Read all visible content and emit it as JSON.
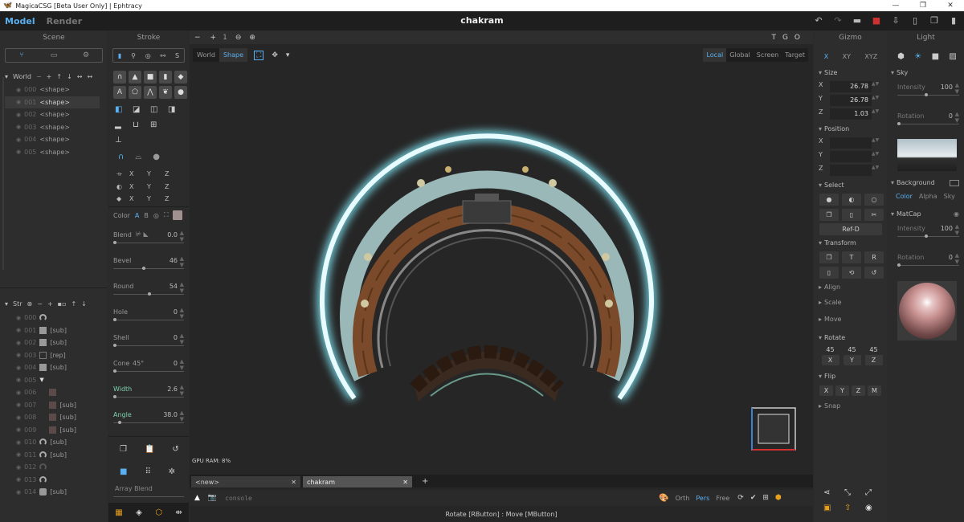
{
  "window": {
    "title": "MagicaCSG [Beta User Only] | Ephtracy",
    "min": "—",
    "max": "❐",
    "close": "✕"
  },
  "menubar": {
    "model": "Model",
    "render": "Render",
    "doc_title": "chakram"
  },
  "scene": {
    "header": "Scene",
    "world_label": "World",
    "world_tools": [
      "+",
      "↑",
      "↓",
      "↔",
      "↔"
    ],
    "items": [
      {
        "num": "000",
        "label": "<shape>"
      },
      {
        "num": "001",
        "label": "<shape>"
      },
      {
        "num": "002",
        "label": "<shape>"
      },
      {
        "num": "003",
        "label": "<shape>"
      },
      {
        "num": "004",
        "label": "<shape>"
      },
      {
        "num": "005",
        "label": "<shape>"
      }
    ],
    "str_label": "Str",
    "str_items": [
      {
        "num": "000",
        "label": ""
      },
      {
        "num": "001",
        "label": "[sub]"
      },
      {
        "num": "002",
        "label": "[sub]"
      },
      {
        "num": "003",
        "label": "[rep]"
      },
      {
        "num": "004",
        "label": "[sub]"
      },
      {
        "num": "005",
        "label": ""
      },
      {
        "num": "006",
        "label": ""
      },
      {
        "num": "007",
        "label": "[sub]"
      },
      {
        "num": "008",
        "label": "[sub]"
      },
      {
        "num": "009",
        "label": "[sub]"
      },
      {
        "num": "010",
        "label": "[sub]"
      },
      {
        "num": "011",
        "label": "[sub]"
      },
      {
        "num": "012",
        "label": ""
      },
      {
        "num": "013",
        "label": ""
      },
      {
        "num": "014",
        "label": "[sub]"
      }
    ]
  },
  "stroke": {
    "header": "Stroke",
    "tab_s": "S",
    "axes": [
      "X",
      "Y",
      "Z"
    ],
    "color_label": "Color",
    "color_a": "A",
    "color_b": "B",
    "blend": {
      "label": "Blend",
      "value": "0.0"
    },
    "bevel": {
      "label": "Bevel",
      "value": "46"
    },
    "round": {
      "label": "Round",
      "value": "54"
    },
    "hole": {
      "label": "Hole",
      "value": "0"
    },
    "shell": {
      "label": "Shell",
      "value": "0"
    },
    "cone": {
      "label": "Cone",
      "angle": "45°",
      "value": "0"
    },
    "width": {
      "label": "Width",
      "value": "2.6"
    },
    "angle": {
      "label": "Angle",
      "value": "38.0"
    },
    "array_blend": "Array Blend"
  },
  "viewport": {
    "zoom_minus": "−",
    "zoom_plus": "+",
    "zoom_val": "1",
    "tgo": [
      "T",
      "G",
      "O"
    ],
    "space_tabs": [
      "World",
      "Shape"
    ],
    "coord_tabs": [
      "Local",
      "Global",
      "Screen",
      "Target"
    ],
    "gpu_ram": "GPU RAM:  8%",
    "tabs": [
      {
        "label": "<new>",
        "close": "✕"
      },
      {
        "label": "chakram",
        "close": "✕"
      }
    ],
    "add_tab": "+",
    "console_placeholder": "console",
    "view_modes": [
      "Orth",
      "Pers",
      "Free"
    ],
    "status": "Rotate [RButton] : Move [MButton]"
  },
  "gizmo": {
    "header": "Gizmo",
    "axis_tabs": [
      "X",
      "XY",
      "XYZ"
    ],
    "size": {
      "label": "Size",
      "x": "26.78",
      "y": "26.78",
      "z": "1.03"
    },
    "position": {
      "label": "Position"
    },
    "select": {
      "label": "Select",
      "refd": "Ref-D"
    },
    "transform": {
      "label": "Transform",
      "t": "T",
      "r": "R"
    },
    "align": "Align",
    "scale": "Scale",
    "move": "Move",
    "rotate": {
      "label": "Rotate",
      "values": [
        "45",
        "45",
        "45"
      ],
      "axes": [
        "X",
        "Y",
        "Z"
      ]
    },
    "flip": {
      "label": "Flip",
      "axes": [
        "X",
        "Y",
        "Z",
        "M"
      ]
    },
    "snap": "Snap"
  },
  "light": {
    "header": "Light",
    "sky": {
      "label": "Sky",
      "intensity_label": "Intensity",
      "intensity": "100",
      "rotation_label": "Rotation",
      "rotation": "0"
    },
    "background": {
      "label": "Background",
      "tabs": [
        "Color",
        "Alpha",
        "Sky"
      ]
    },
    "matcap": {
      "label": "MatCap",
      "intensity_label": "Intensity",
      "intensity": "100",
      "rotation_label": "Rotation",
      "rotation": "0"
    }
  },
  "colors": {
    "accent": "#5ab0f0",
    "ring_glow": "#7fe6f5",
    "ring_body": "#7a4a2a",
    "save_red": "#d03030",
    "gizmo_orange": "#e8a020"
  }
}
